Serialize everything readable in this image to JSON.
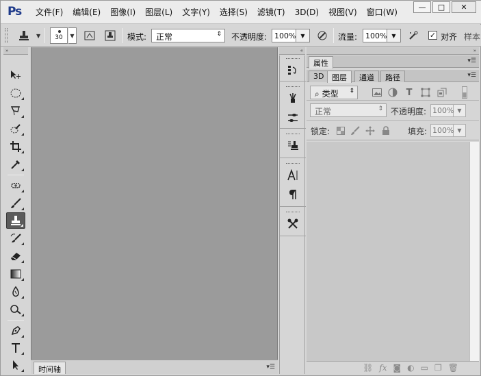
{
  "app": {
    "logo": "Ps"
  },
  "menu": [
    "文件(F)",
    "编辑(E)",
    "图像(I)",
    "图层(L)",
    "文字(Y)",
    "选择(S)",
    "滤镜(T)",
    "3D(D)",
    "视图(V)",
    "窗口(W)"
  ],
  "window_controls": {
    "minimize": "—",
    "maximize": "□",
    "close": "✕"
  },
  "options_bar": {
    "brush_size": "30",
    "mode_label": "模式:",
    "mode_value": "正常",
    "opacity_label": "不透明度:",
    "opacity_value": "100%",
    "flow_label": "流量:",
    "flow_value": "100%",
    "aligned_label": "对齐",
    "aligned_checked": "✓",
    "sample_label": "样本"
  },
  "timeline": {
    "tab_label": "时间轴"
  },
  "properties_panel": {
    "tab_label": "属性"
  },
  "layers_panel": {
    "tabs": [
      "3D",
      "图层",
      "通道",
      "路径"
    ],
    "active_tab": "图层",
    "filter_label": "类型",
    "blend_mode": "正常",
    "opacity_label": "不透明度:",
    "opacity_value": "100%",
    "lock_label": "锁定:",
    "fill_label": "填充:",
    "fill_value": "100%"
  },
  "tools": [
    "move",
    "marquee",
    "lasso",
    "quick-select",
    "crop",
    "eyedropper",
    "spot-heal",
    "brush",
    "clone-stamp",
    "history-brush",
    "eraser",
    "gradient",
    "blur",
    "dodge",
    "pen",
    "type",
    "path-select"
  ],
  "active_tool": "clone-stamp",
  "colors": {
    "canvas": "#9b9b9b",
    "panel": "#d6d6d6",
    "logo": "#1e3a8a"
  }
}
